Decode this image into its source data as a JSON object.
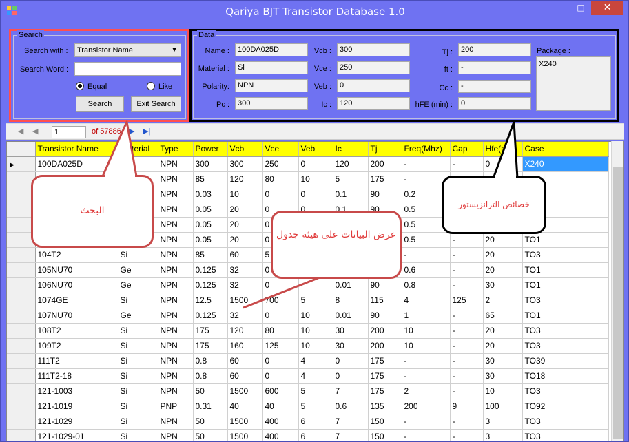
{
  "window": {
    "title": "Qariya BJT Transistor Database 1.0",
    "min": "—",
    "max": "□",
    "close": "✕"
  },
  "search": {
    "legend": "Search",
    "search_with_label": "Search with :",
    "search_with_value": "Transistor Name",
    "search_word_label": "Search Word :",
    "search_word_value": "",
    "radio_equal": "Equal",
    "radio_like": "Like",
    "search_button": "Search",
    "exit_button": "Exit Search"
  },
  "data_panel": {
    "legend": "Data",
    "name_label": "Name :",
    "name_value": "100DA025D",
    "material_label": "Material :",
    "material_value": "Si",
    "polarity_label": "Polarity:",
    "polarity_value": "NPN",
    "pc_label": "Pc :",
    "pc_value": "300",
    "vcb_label": "Vcb :",
    "vcb_value": "300",
    "vce_label": "Vce :",
    "vce_value": "250",
    "veb_label": "Veb :",
    "veb_value": "0",
    "ic_label": "Ic :",
    "ic_value": "120",
    "tj_label": "Tj :",
    "tj_value": "200",
    "ft_label": "ft :",
    "ft_value": "-",
    "cc_label": "Cc :",
    "cc_value": "-",
    "hfe_label": "hFE (min) :",
    "hfe_value": "0",
    "package_label": "Package :",
    "package_value": "X240"
  },
  "navigator": {
    "first": "|◀",
    "prev": "◀",
    "position": "1",
    "of_text": "of 57886",
    "next": "▶",
    "last": "▶|"
  },
  "grid": {
    "columns": [
      "Transistor Name",
      "Material",
      "Type",
      "Power",
      "Vcb",
      "Vce",
      "Veb",
      "Ic",
      "Tj",
      "Freq(Mhz)",
      "Cap",
      "Hfe(min)",
      "Case"
    ],
    "rows": [
      [
        "100DA025D",
        "Si",
        "NPN",
        "300",
        "300",
        "250",
        "0",
        "120",
        "200",
        "-",
        "-",
        "0",
        "X240"
      ],
      [
        "",
        "",
        "NPN",
        "85",
        "120",
        "80",
        "10",
        "5",
        "175",
        "-",
        "",
        "",
        "TO3"
      ],
      [
        "",
        "",
        "NPN",
        "0.03",
        "10",
        "0",
        "0",
        "0.1",
        "90",
        "0.2",
        "",
        "",
        ""
      ],
      [
        "",
        "",
        "NPN",
        "0.05",
        "20",
        "0",
        "0",
        "0.1",
        "90",
        "0.5",
        "",
        "",
        ""
      ],
      [
        "",
        "",
        "NPN",
        "0.05",
        "20",
        "0",
        "",
        "",
        "",
        "0.5",
        "",
        "",
        ""
      ],
      [
        "",
        "",
        "NPN",
        "0.05",
        "20",
        "0",
        "",
        "",
        "",
        "0.5",
        "-",
        "20",
        "TO1"
      ],
      [
        "104T2",
        "Si",
        "NPN",
        "85",
        "60",
        "5",
        "",
        "",
        "",
        "-",
        "-",
        "20",
        "TO3"
      ],
      [
        "105NU70",
        "Ge",
        "NPN",
        "0.125",
        "32",
        "0",
        "",
        "",
        "",
        "0.6",
        "-",
        "20",
        "TO1"
      ],
      [
        "106NU70",
        "Ge",
        "NPN",
        "0.125",
        "32",
        "0",
        "",
        "0.01",
        "90",
        "0.8",
        "-",
        "30",
        "TO1"
      ],
      [
        "1074GE",
        "Si",
        "NPN",
        "12.5",
        "1500",
        "700",
        "5",
        "8",
        "115",
        "4",
        "125",
        "2",
        "TO3"
      ],
      [
        "107NU70",
        "Ge",
        "NPN",
        "0.125",
        "32",
        "0",
        "10",
        "0.01",
        "90",
        "1",
        "-",
        "65",
        "TO1"
      ],
      [
        "108T2",
        "Si",
        "NPN",
        "175",
        "120",
        "80",
        "10",
        "30",
        "200",
        "10",
        "-",
        "20",
        "TO3"
      ],
      [
        "109T2",
        "Si",
        "NPN",
        "175",
        "160",
        "125",
        "10",
        "30",
        "200",
        "10",
        "-",
        "20",
        "TO3"
      ],
      [
        "111T2",
        "Si",
        "NPN",
        "0.8",
        "60",
        "0",
        "4",
        "0",
        "175",
        "-",
        "-",
        "30",
        "TO39"
      ],
      [
        "111T2-18",
        "Si",
        "NPN",
        "0.8",
        "60",
        "0",
        "4",
        "0",
        "175",
        "-",
        "-",
        "30",
        "TO18"
      ],
      [
        "121-1003",
        "Si",
        "NPN",
        "50",
        "1500",
        "600",
        "5",
        "7",
        "175",
        "2",
        "-",
        "10",
        "TO3"
      ],
      [
        "121-1019",
        "Si",
        "PNP",
        "0.31",
        "40",
        "40",
        "5",
        "0.6",
        "135",
        "200",
        "9",
        "100",
        "TO92"
      ],
      [
        "121-1029",
        "Si",
        "NPN",
        "50",
        "1500",
        "400",
        "6",
        "7",
        "150",
        "-",
        "-",
        "3",
        "TO3"
      ],
      [
        "121-1029-01",
        "Si",
        "NPN",
        "50",
        "1500",
        "400",
        "6",
        "7",
        "150",
        "-",
        "-",
        "3",
        "TO3"
      ]
    ]
  },
  "annotations": {
    "search_callout": "البحث",
    "table_callout": "عرض البيانات على هيئة جدول",
    "props_callout": "خصائص الترانزيستور"
  },
  "colors": {
    "window_bg": "#6f72f2",
    "header_bg": "#ffff00",
    "selection": "#3399ff",
    "callout_red": "#c84a4a"
  }
}
